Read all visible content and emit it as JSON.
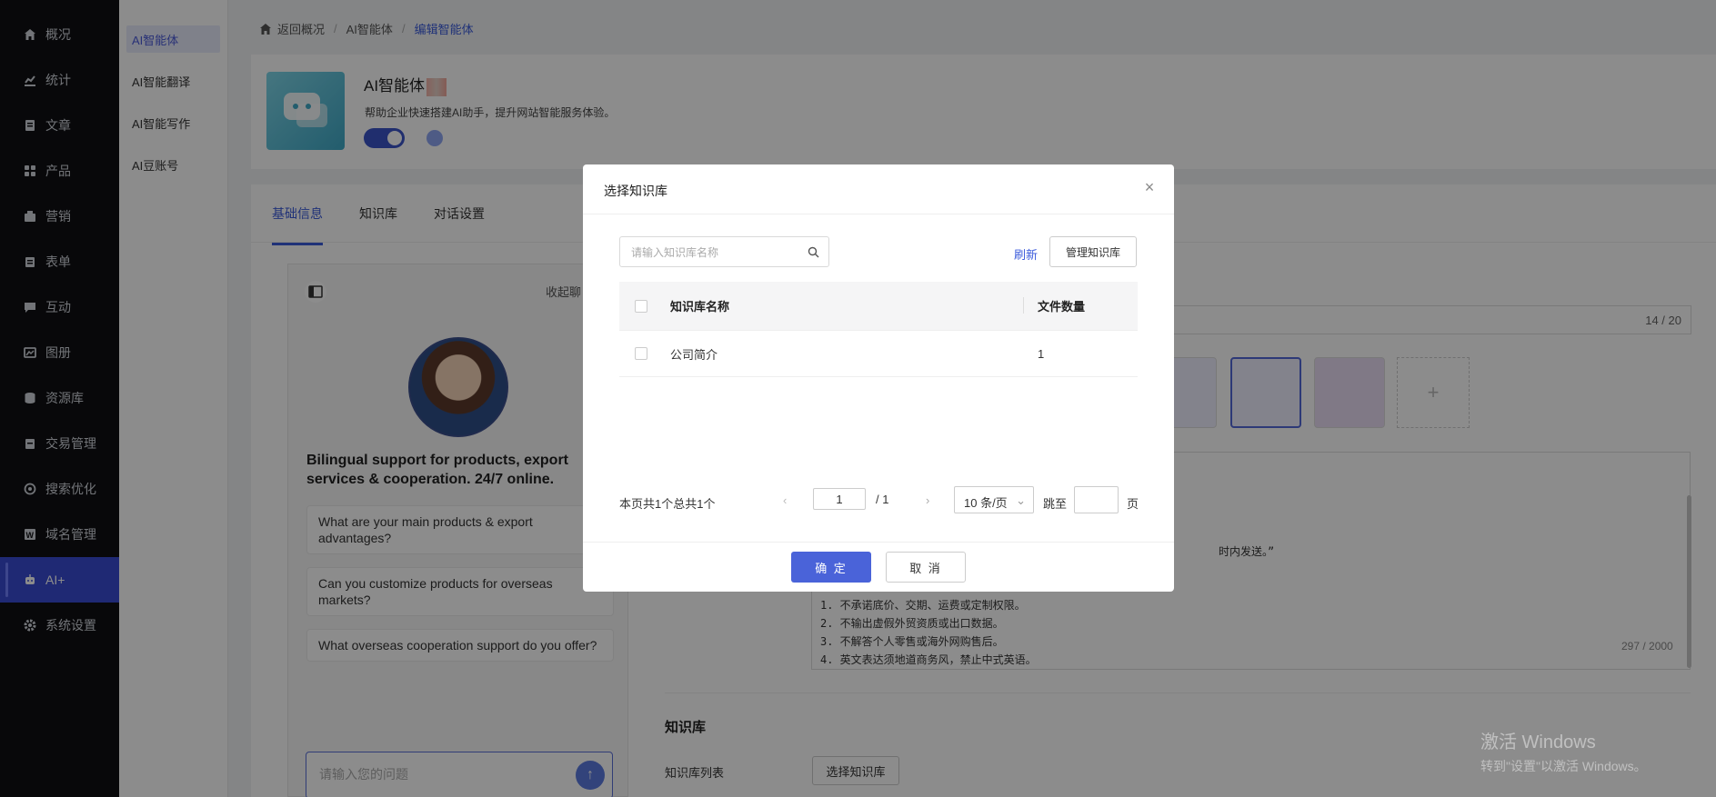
{
  "sidebar": {
    "items": [
      {
        "label": "概况",
        "icon": "home-icon"
      },
      {
        "label": "统计",
        "icon": "chart-icon"
      },
      {
        "label": "文章",
        "icon": "article-icon"
      },
      {
        "label": "产品",
        "icon": "grid-icon"
      },
      {
        "label": "营销",
        "icon": "marketing-icon"
      },
      {
        "label": "表单",
        "icon": "form-icon"
      },
      {
        "label": "互动",
        "icon": "chat-icon"
      },
      {
        "label": "图册",
        "icon": "album-icon"
      },
      {
        "label": "资源库",
        "icon": "database-icon"
      },
      {
        "label": "交易管理",
        "icon": "trade-icon"
      },
      {
        "label": "搜索优化",
        "icon": "seo-icon"
      },
      {
        "label": "域名管理",
        "icon": "domain-icon"
      },
      {
        "label": "AI+",
        "icon": "robot-icon",
        "active": true
      },
      {
        "label": "系统设置",
        "icon": "gear-icon"
      }
    ]
  },
  "subnav": {
    "items": [
      "AI智能体",
      "AI智能翻译",
      "AI智能写作",
      "AI豆账号"
    ]
  },
  "breadcrumb": {
    "home": "返回概况",
    "mid": "AI智能体",
    "current": "编辑智能体"
  },
  "header": {
    "title": "AI智能体",
    "desc": "帮助企业快速搭建AI助手，提升网站智能服务体验。"
  },
  "tabs": [
    "基础信息",
    "知识库",
    "对话设置"
  ],
  "preview": {
    "collapse": "收起聊",
    "tagline": "Bilingual support for products, export services & cooperation. 24/7 online.",
    "questions": [
      "What are your main products & export advantages?",
      "Can you customize products for overseas markets?",
      "What overseas cooperation support do you offer?"
    ],
    "input_placeholder": "请输入您的问题"
  },
  "form": {
    "name_counter": "14 / 20",
    "prompt_fragment": "时内发送。”",
    "prompt_lines": [
      "1. 不承诺底价、交期、运费或定制权限。",
      "2. 不输出虚假外贸资质或出口数据。",
      "3. 不解答个人零售或海外网购售后。",
      "4. 英文表达须地道商务风，禁止中式英语。"
    ],
    "prompt_counter": "297 / 2000",
    "kb_section": "知识库",
    "kb_label": "知识库列表",
    "kb_button": "选择知识库"
  },
  "modal": {
    "title": "选择知识库",
    "search_placeholder": "请输入知识库名称",
    "refresh": "刷新",
    "manage": "管理知识库",
    "columns": [
      "知识库名称",
      "文件数量"
    ],
    "rows": [
      {
        "name": "公司简介",
        "count": "1"
      }
    ],
    "pager": {
      "info": "本页共1个总共1个",
      "page": "1",
      "total": "/ 1",
      "size": "10 条/页",
      "jump": "跳至",
      "unit": "页"
    },
    "ok": "确 定",
    "cancel": "取 消"
  },
  "watermark": {
    "line1": "激活 Windows",
    "line2": "转到\"设置\"以激活 Windows。"
  }
}
